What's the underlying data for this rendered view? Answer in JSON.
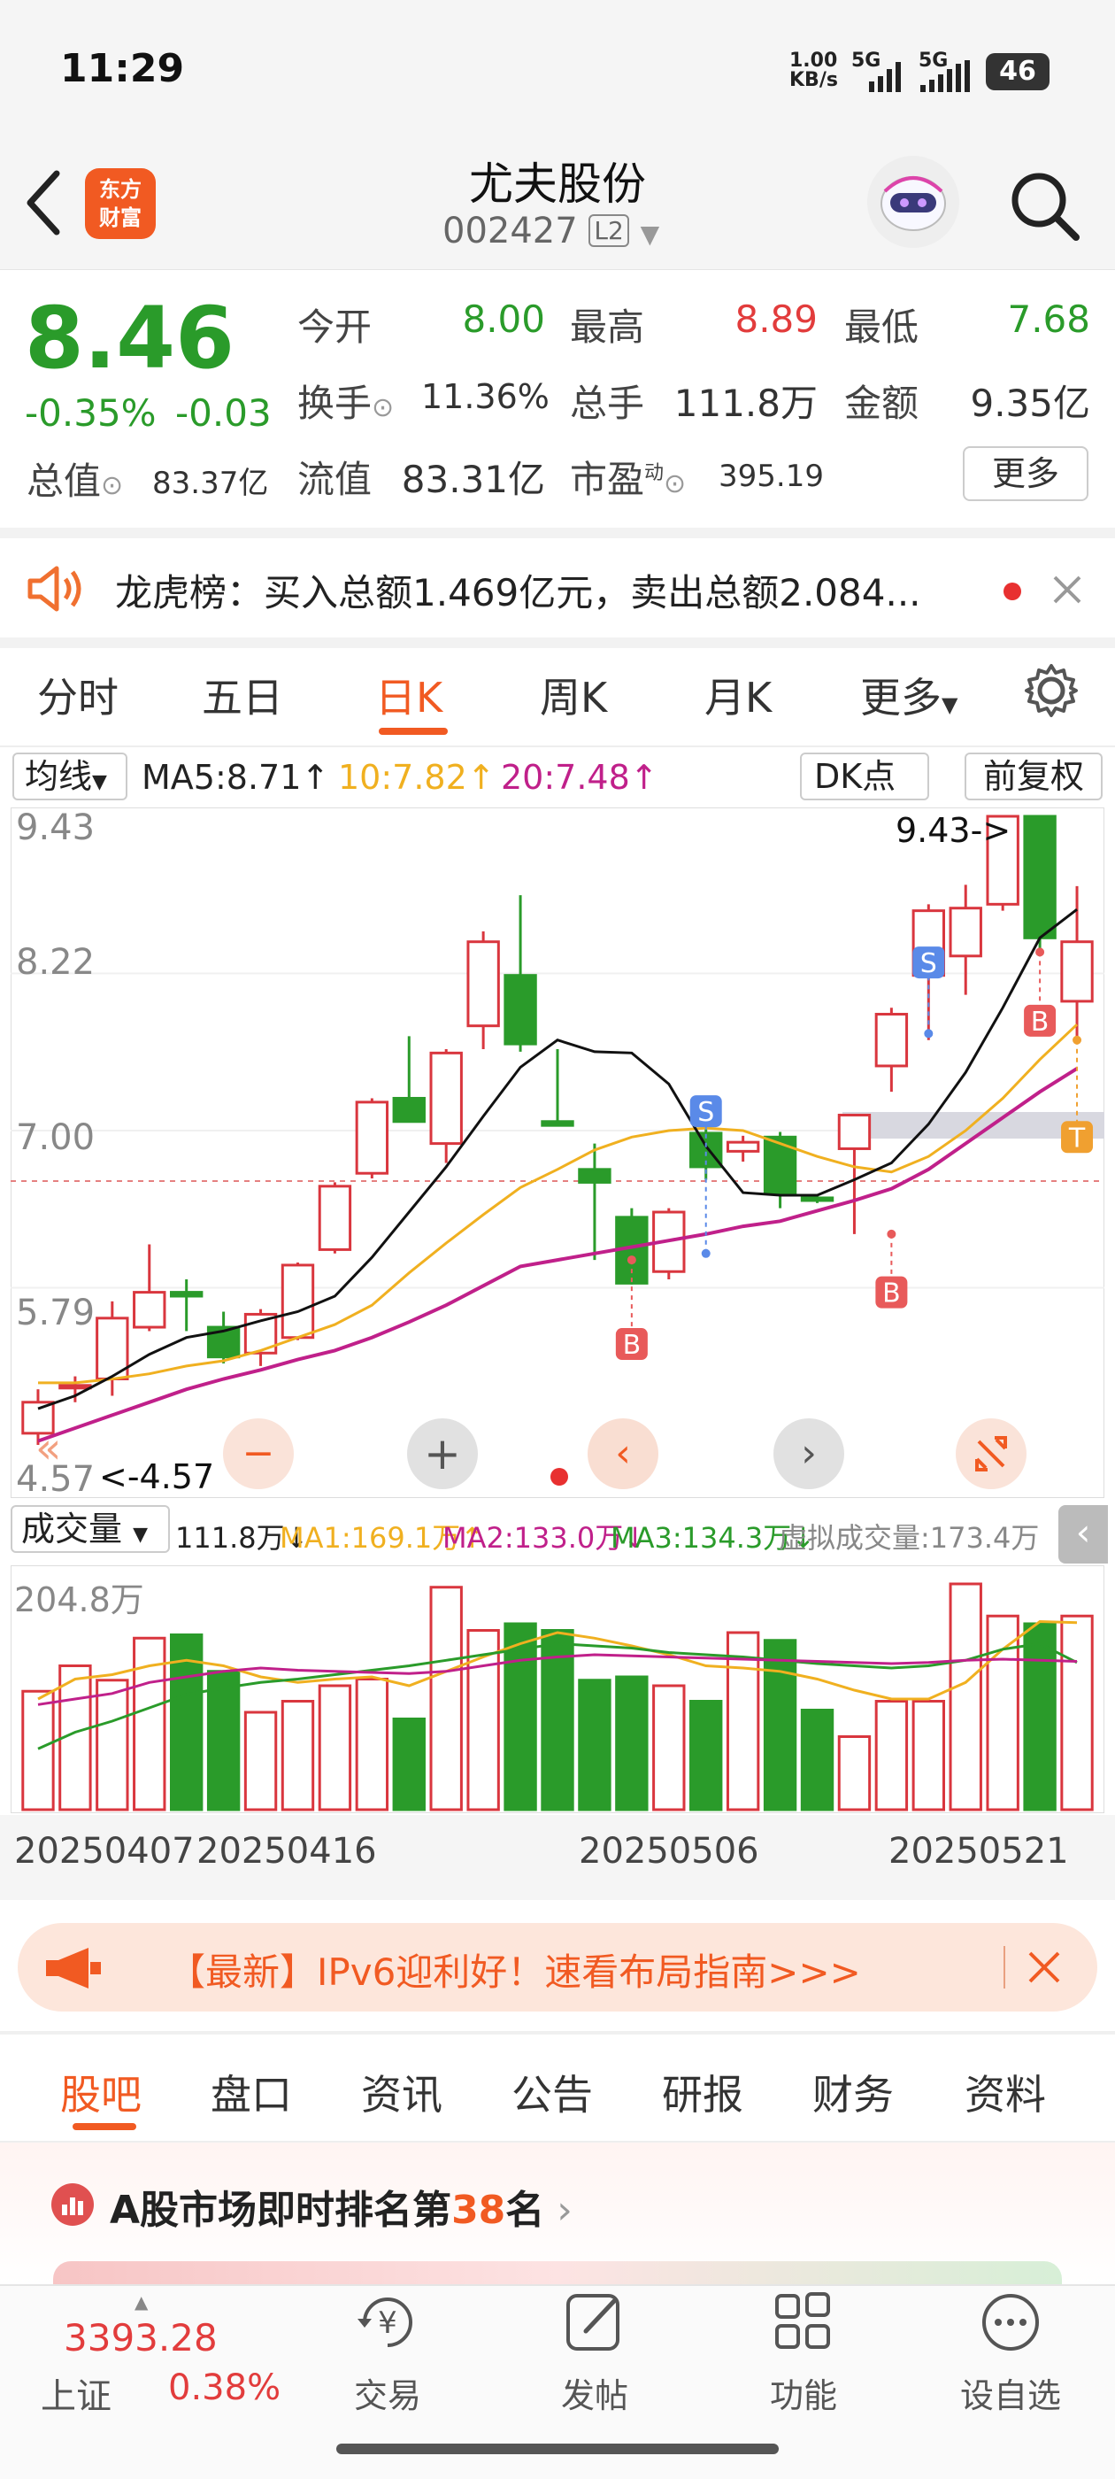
{
  "status_bar": {
    "time": "11:29",
    "net_speed_top": "1.00",
    "net_speed_unit": "KB/s",
    "sig1": "5G",
    "sig2": "5G",
    "battery": "46"
  },
  "header": {
    "logo_top": "东方",
    "logo_bottom": "财富",
    "stock_name": "尤夫股份",
    "stock_code": "002427",
    "level_badge": "L2"
  },
  "quote": {
    "price": "8.46",
    "change_pct": "-0.35%",
    "change_amt": "-0.03",
    "open_label": "今开",
    "open": "8.00",
    "high_label": "最高",
    "high": "8.89",
    "low_label": "最低",
    "low": "7.68",
    "turnover_label": "换手",
    "turnover": "11.36%",
    "volume_label": "总手",
    "volume": "111.8万",
    "amount_label": "金额",
    "amount": "9.35亿",
    "mktcap_label": "总值",
    "mktcap": "83.37亿",
    "float_label": "流值",
    "float": "83.31亿",
    "pe_label": "市盈",
    "pe_sup": "动",
    "pe": "395.19",
    "more_button": "更多"
  },
  "ticker": {
    "text": "龙虎榜：买入总额1.469亿元，卖出总额2.084..."
  },
  "chart_tabs": [
    "分时",
    "五日",
    "日K",
    "周K",
    "月K",
    "更多"
  ],
  "chart_tab_active": "日K",
  "ma_bar": {
    "ma_button": "均线",
    "ma5": "MA5:8.71↑",
    "ma10": "10:7.82↑",
    "ma20": "20:7.48↑",
    "dk_button": "DK点",
    "adjust_button": "前复权"
  },
  "axis": {
    "y1": "9.43",
    "y2": "8.22",
    "y3": "7.00",
    "y4": "5.79",
    "y5": "4.57",
    "max_label": "9.43->",
    "min_label": "<-4.57"
  },
  "volume_bar": {
    "button": "成交量",
    "vol": "111.8万↓",
    "ma1": "MA1:169.1万↑",
    "ma2": "MA2:133.0万↓",
    "ma3": "MA3:134.3万↓",
    "virtual": "虚拟成交量:173.4万",
    "ymax": "204.8万"
  },
  "dates": [
    "20250407",
    "20250416",
    "20250506",
    "20250521"
  ],
  "signals": {
    "s": "S",
    "b": "B",
    "t": "T"
  },
  "chart_data": {
    "type": "candlestick",
    "ylim": [
      4.57,
      9.43
    ],
    "candles": [
      {
        "o": 4.66,
        "h": 5.0,
        "l": 4.57,
        "c": 4.9
      },
      {
        "o": 5.02,
        "h": 5.1,
        "l": 4.9,
        "c": 5.03
      },
      {
        "o": 5.08,
        "h": 5.68,
        "l": 4.95,
        "c": 5.55
      },
      {
        "o": 5.48,
        "h": 6.12,
        "l": 5.45,
        "c": 5.75
      },
      {
        "o": 5.75,
        "h": 5.85,
        "l": 5.45,
        "c": 5.72
      },
      {
        "o": 5.48,
        "h": 5.6,
        "l": 5.2,
        "c": 5.25
      },
      {
        "o": 5.28,
        "h": 5.62,
        "l": 5.18,
        "c": 5.58
      },
      {
        "o": 5.4,
        "h": 5.98,
        "l": 5.38,
        "c": 5.96
      },
      {
        "o": 6.08,
        "h": 6.6,
        "l": 6.05,
        "c": 6.57
      },
      {
        "o": 6.67,
        "h": 7.25,
        "l": 6.63,
        "c": 7.22
      },
      {
        "o": 7.25,
        "h": 7.73,
        "l": 7.12,
        "c": 7.07
      },
      {
        "o": 6.9,
        "h": 7.63,
        "l": 6.75,
        "c": 7.6
      },
      {
        "o": 7.81,
        "h": 8.54,
        "l": 7.63,
        "c": 8.46
      },
      {
        "o": 8.2,
        "h": 8.82,
        "l": 7.61,
        "c": 7.67
      },
      {
        "o": 7.07,
        "h": 7.63,
        "l": 7.05,
        "c": 7.04
      },
      {
        "o": 6.7,
        "h": 6.9,
        "l": 6.0,
        "c": 6.6
      },
      {
        "o": 6.33,
        "h": 6.4,
        "l": 5.81,
        "c": 5.82
      },
      {
        "o": 5.91,
        "h": 6.4,
        "l": 5.85,
        "c": 6.37
      },
      {
        "o": 6.98,
        "h": 7.12,
        "l": 6.62,
        "c": 6.72
      },
      {
        "o": 6.84,
        "h": 6.96,
        "l": 6.76,
        "c": 6.91
      },
      {
        "o": 6.95,
        "h": 6.99,
        "l": 6.4,
        "c": 6.52
      },
      {
        "o": 6.48,
        "h": 6.51,
        "l": 6.44,
        "c": 6.47
      },
      {
        "o": 6.86,
        "h": 7.1,
        "l": 6.2,
        "c": 7.12
      },
      {
        "o": 7.5,
        "h": 7.95,
        "l": 7.3,
        "c": 7.9
      },
      {
        "o": 8.2,
        "h": 8.75,
        "l": 7.7,
        "c": 8.7
      },
      {
        "o": 8.35,
        "h": 8.9,
        "l": 8.05,
        "c": 8.72
      },
      {
        "o": 8.75,
        "h": 9.43,
        "l": 8.7,
        "c": 9.43
      },
      {
        "o": 9.43,
        "h": 9.43,
        "l": 8.38,
        "c": 8.49
      },
      {
        "o": 8.0,
        "h": 8.89,
        "l": 7.68,
        "c": 8.46
      }
    ],
    "ma5": [
      4.85,
      4.95,
      5.1,
      5.27,
      5.4,
      5.45,
      5.53,
      5.6,
      5.72,
      6.02,
      6.37,
      6.72,
      7.11,
      7.49,
      7.7,
      7.61,
      7.6,
      7.36,
      6.88,
      6.52,
      6.5,
      6.5,
      6.62,
      6.75,
      7.05,
      7.45,
      7.95,
      8.49,
      8.71
    ],
    "ma10": [
      5.05,
      5.05,
      5.08,
      5.12,
      5.18,
      5.22,
      5.3,
      5.4,
      5.5,
      5.65,
      5.9,
      6.13,
      6.35,
      6.56,
      6.7,
      6.85,
      6.95,
      7.0,
      7.02,
      7.0,
      6.9,
      6.8,
      6.72,
      6.68,
      6.8,
      7.0,
      7.25,
      7.55,
      7.82
    ],
    "ma20": [
      4.6,
      4.7,
      4.8,
      4.9,
      5.0,
      5.08,
      5.15,
      5.23,
      5.3,
      5.4,
      5.52,
      5.65,
      5.8,
      5.95,
      6.0,
      6.05,
      6.1,
      6.15,
      6.2,
      6.26,
      6.3,
      6.38,
      6.46,
      6.55,
      6.7,
      6.9,
      7.1,
      7.3,
      7.48
    ],
    "volume_max": 204.8,
    "volume": [
      107,
      130,
      117,
      155,
      158,
      125,
      88,
      98,
      112,
      118,
      82,
      201,
      162,
      168,
      162,
      117,
      120,
      112,
      98,
      160,
      153,
      90,
      66,
      98,
      98,
      204,
      175,
      168,
      175
    ],
    "volume_ma1": [
      100,
      118,
      122,
      130,
      135,
      130,
      120,
      115,
      118,
      120,
      112,
      125,
      138,
      150,
      160,
      155,
      148,
      140,
      130,
      128,
      125,
      118,
      108,
      100,
      100,
      115,
      145,
      170,
      169
    ],
    "volume_ma2": [
      55,
      70,
      80,
      92,
      104,
      110,
      115,
      118,
      122,
      126,
      130,
      135,
      140,
      145,
      150,
      148,
      146,
      142,
      140,
      138,
      135,
      132,
      130,
      128,
      130,
      135,
      145,
      150,
      133
    ],
    "volume_ma3": [
      95,
      100,
      105,
      115,
      120,
      125,
      128,
      126,
      125,
      124,
      123,
      125,
      130,
      135,
      138,
      140,
      139,
      138,
      137,
      136,
      135,
      134,
      133,
      132,
      133,
      135,
      136,
      135,
      134
    ]
  },
  "notice": {
    "text": "【最新】IPv6迎利好！速看布局指南>>>"
  },
  "bottom_tabs": [
    "股吧",
    "盘口",
    "资讯",
    "公告",
    "研报",
    "财务",
    "资料"
  ],
  "bottom_tab_active": "股吧",
  "ranking": {
    "prefix": "A股市场即时排名第",
    "rank": "38",
    "suffix": "名"
  },
  "index_quote": {
    "value": "3393.28",
    "name": "上证",
    "change": "0.38%"
  },
  "nav": [
    "交易",
    "发帖",
    "功能",
    "设自选"
  ]
}
